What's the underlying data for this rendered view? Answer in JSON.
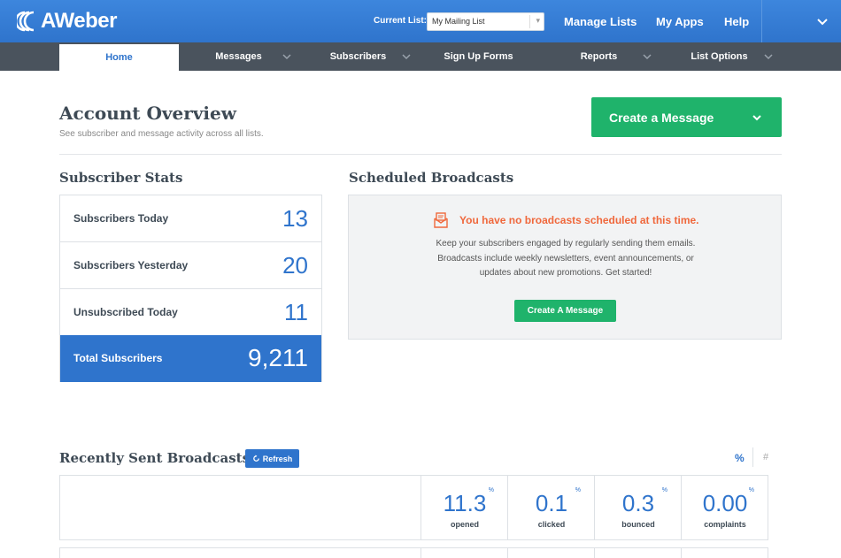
{
  "app": {
    "logo_text": "AWeber"
  },
  "topbar": {
    "current_list_label": "Current List:",
    "current_list_value": "My Mailing List",
    "links": [
      "Manage Lists",
      "My Apps",
      "Help"
    ]
  },
  "nav": {
    "items": [
      {
        "label": "Home"
      },
      {
        "label": "Messages"
      },
      {
        "label": "Subscribers"
      },
      {
        "label": "Sign Up Forms"
      },
      {
        "label": "Reports"
      },
      {
        "label": "List Options"
      }
    ]
  },
  "header": {
    "title": "Account Overview",
    "subtitle": "See subscriber and message activity across all lists.",
    "create_button": "Create a Message"
  },
  "subscriber_stats": {
    "title": "Subscriber Stats",
    "rows": [
      {
        "label": "Subscribers Today",
        "value": "13"
      },
      {
        "label": "Subscribers Yesterday",
        "value": "20"
      },
      {
        "label": "Unsubscribed Today",
        "value": "11"
      },
      {
        "label": "Total Subscribers",
        "value": "9,211"
      }
    ]
  },
  "scheduled": {
    "title": "Scheduled Broadcasts",
    "alert": "You have no broadcasts scheduled at this time.",
    "line1": "Keep your subscribers engaged by regularly sending them emails.",
    "line2": "Broadcasts include weekly newsletters, event announcements, or",
    "line3": "updates about new promotions. Get started!",
    "button": "Create A Message"
  },
  "recent": {
    "title": "Recently Sent Broadcasts",
    "refresh": "Refresh",
    "toggle_percent": "%",
    "toggle_count": "#",
    "metrics": [
      {
        "value": "11.3",
        "unit": "%",
        "label": "opened"
      },
      {
        "value": "0.1",
        "unit": "%",
        "label": "clicked"
      },
      {
        "value": "0.3",
        "unit": "%",
        "label": "bounced"
      },
      {
        "value": "0.00",
        "unit": "%",
        "label": "complaints"
      }
    ]
  },
  "colors": {
    "brand_blue": "#2f74cc",
    "nav_gray": "#4a535d",
    "action_green": "#1fb36b",
    "alert_orange": "#f0683c"
  }
}
